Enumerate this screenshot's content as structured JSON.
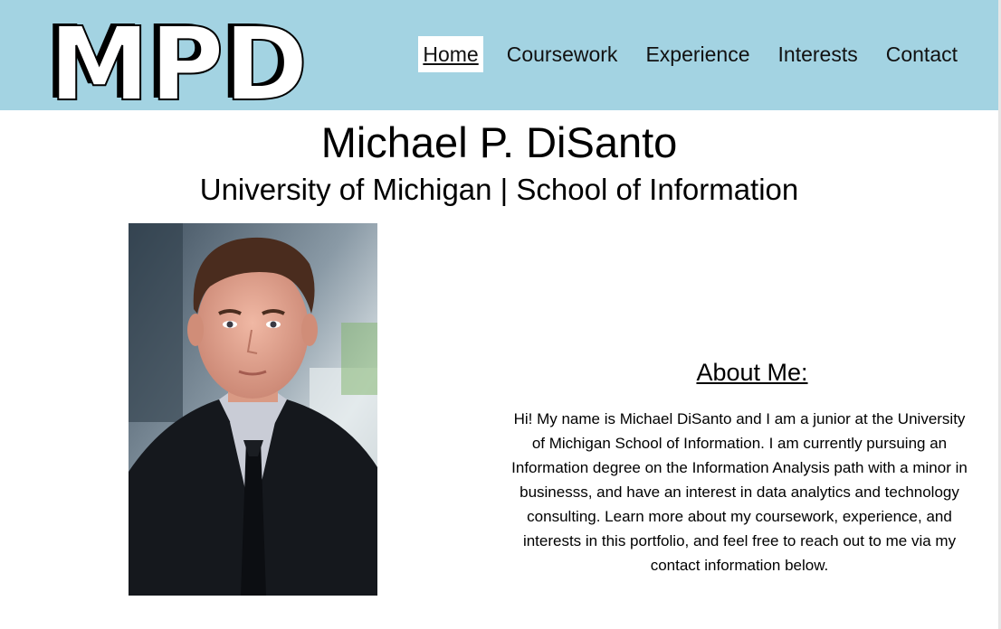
{
  "header": {
    "logo_text": "MPD",
    "background_color": "#a3d3e2",
    "nav": [
      {
        "label": "Home",
        "active": true
      },
      {
        "label": "Coursework",
        "active": false
      },
      {
        "label": "Experience",
        "active": false
      },
      {
        "label": "Interests",
        "active": false
      },
      {
        "label": "Contact",
        "active": false
      }
    ]
  },
  "main": {
    "name": "Michael P. DiSanto",
    "subtitle": "University of Michigan | School of Information",
    "about": {
      "heading": "About Me:",
      "text": "Hi! My name is Michael DiSanto and I am a junior at the University of Michigan School of Information. I am currently pursuing an Information degree on the Information Analysis path with a minor in businesss, and have an interest in data analytics and technology consulting. Learn more about my coursework, experience, and interests in this portfolio, and feel free to reach out to me via my contact information below."
    }
  }
}
